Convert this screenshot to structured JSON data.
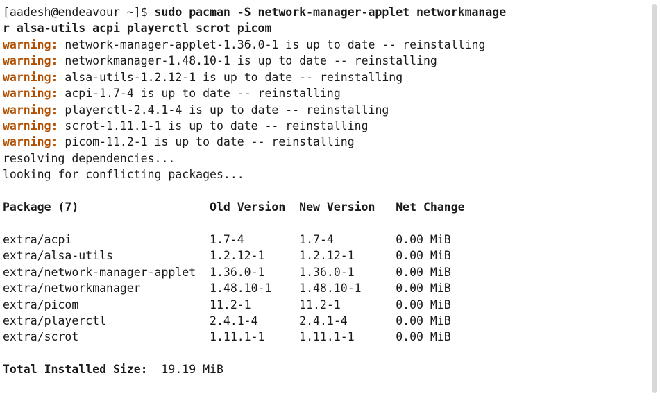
{
  "prompt": {
    "user_host": "[aadesh@endeavour ~]$",
    "command": "sudo pacman -S network-manager-applet networkmanager alsa-utils acpi playerctl scrot picom"
  },
  "warnings": [
    "network-manager-applet-1.36.0-1 is up to date -- reinstalling",
    "networkmanager-1.48.10-1 is up to date -- reinstalling",
    "alsa-utils-1.2.12-1 is up to date -- reinstalling",
    "acpi-1.7-4 is up to date -- reinstalling",
    "playerctl-2.4.1-4 is up to date -- reinstalling",
    "scrot-1.11.1-1 is up to date -- reinstalling",
    "picom-11.2-1 is up to date -- reinstalling"
  ],
  "warn_prefix": "warning:",
  "status": {
    "resolving": "resolving dependencies...",
    "conflicts": "looking for conflicting packages..."
  },
  "table": {
    "header": {
      "pkg": "Package (7)",
      "old": "Old Version",
      "new": "New Version",
      "net": "Net Change"
    },
    "rows": [
      {
        "name": "extra/acpi",
        "old": "1.7-4",
        "new": "1.7-4",
        "net": "0.00 MiB"
      },
      {
        "name": "extra/alsa-utils",
        "old": "1.2.12-1",
        "new": "1.2.12-1",
        "net": "0.00 MiB"
      },
      {
        "name": "extra/network-manager-applet",
        "old": "1.36.0-1",
        "new": "1.36.0-1",
        "net": "0.00 MiB"
      },
      {
        "name": "extra/networkmanager",
        "old": "1.48.10-1",
        "new": "1.48.10-1",
        "net": "0.00 MiB"
      },
      {
        "name": "extra/picom",
        "old": "11.2-1",
        "new": "11.2-1",
        "net": "0.00 MiB"
      },
      {
        "name": "extra/playerctl",
        "old": "2.4.1-4",
        "new": "2.4.1-4",
        "net": "0.00 MiB"
      },
      {
        "name": "extra/scrot",
        "old": "1.11.1-1",
        "new": "1.11.1-1",
        "net": "0.00 MiB"
      }
    ]
  },
  "total": {
    "label": "Total Installed Size:",
    "value": "19.19 MiB"
  },
  "cols": {
    "name": 30,
    "old": 13,
    "new": 14
  }
}
